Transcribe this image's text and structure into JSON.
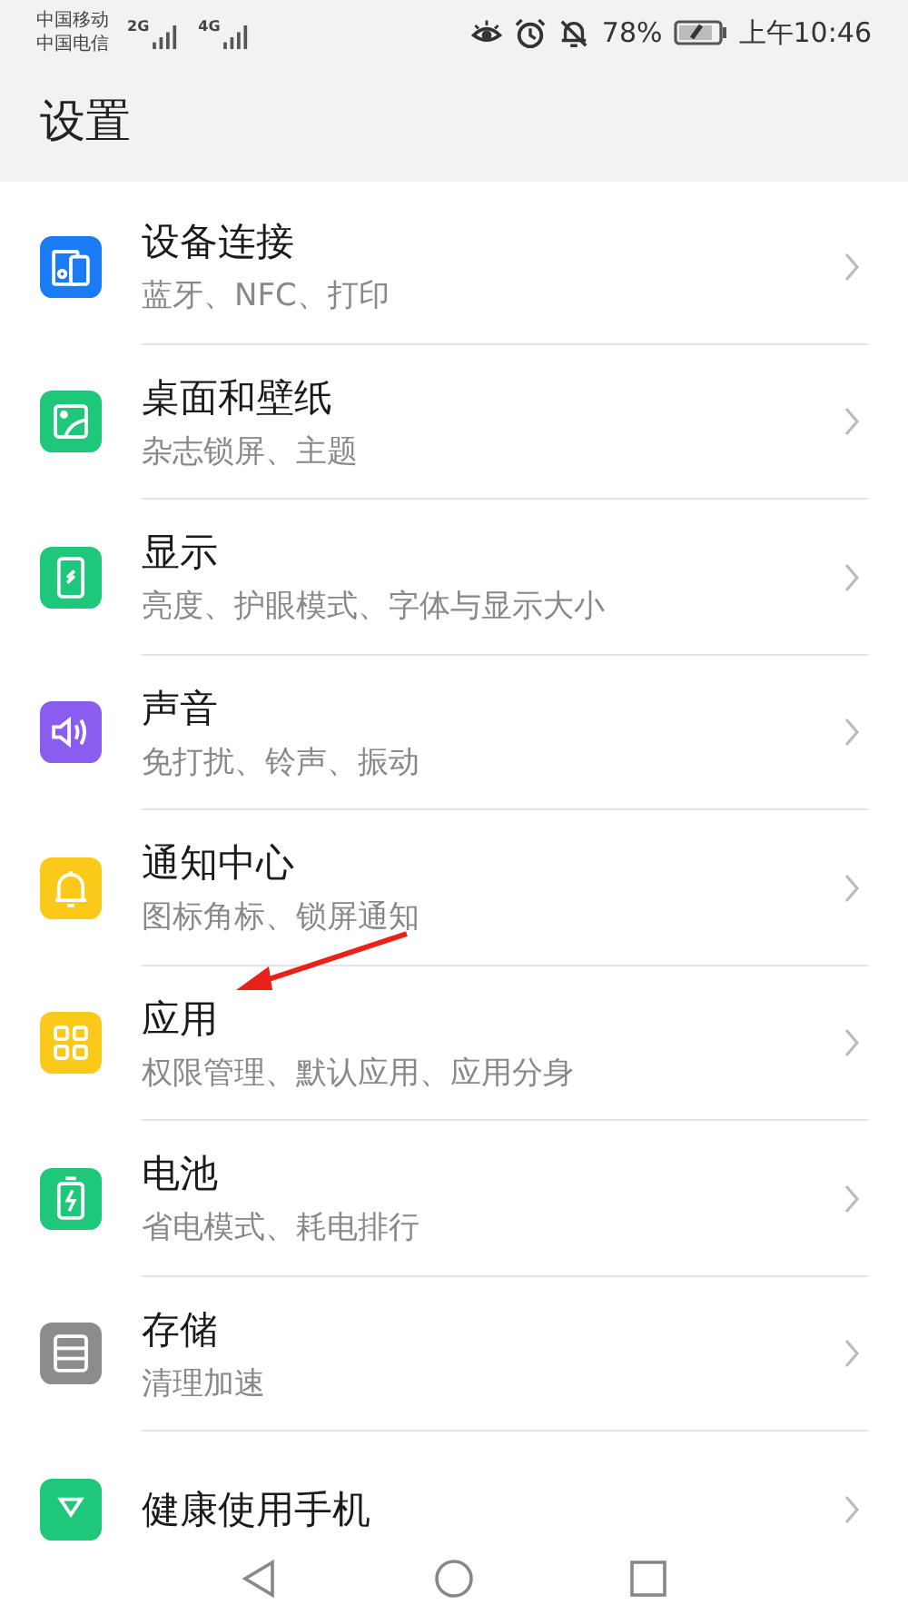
{
  "status_bar": {
    "carriers": [
      "中国移动",
      "中国电信"
    ],
    "networks": [
      "2G",
      "4G"
    ],
    "battery": "78%",
    "time": "上午10:46"
  },
  "header": {
    "title": "设置"
  },
  "items": [
    {
      "kind": "devices",
      "color": "#1a7cf5",
      "title": "设备连接",
      "subtitle": "蓝牙、NFC、打印"
    },
    {
      "kind": "wallpaper",
      "color": "#1ec77a",
      "title": "桌面和壁纸",
      "subtitle": "杂志锁屏、主题"
    },
    {
      "kind": "display",
      "color": "#1ec77a",
      "title": "显示",
      "subtitle": "亮度、护眼模式、字体与显示大小"
    },
    {
      "kind": "sound",
      "color": "#8a5cf0",
      "title": "声音",
      "subtitle": "免打扰、铃声、振动"
    },
    {
      "kind": "bell",
      "color": "#fbc91a",
      "title": "通知中心",
      "subtitle": "图标角标、锁屏通知"
    },
    {
      "kind": "apps",
      "color": "#fbc91a",
      "title": "应用",
      "subtitle": "权限管理、默认应用、应用分身"
    },
    {
      "kind": "battery",
      "color": "#1ec77a",
      "title": "电池",
      "subtitle": "省电模式、耗电排行"
    },
    {
      "kind": "storage",
      "color": "#8c8c8c",
      "title": "存储",
      "subtitle": "清理加速"
    },
    {
      "kind": "health",
      "color": "#1ec77a",
      "title": "健康使用手机"
    }
  ]
}
